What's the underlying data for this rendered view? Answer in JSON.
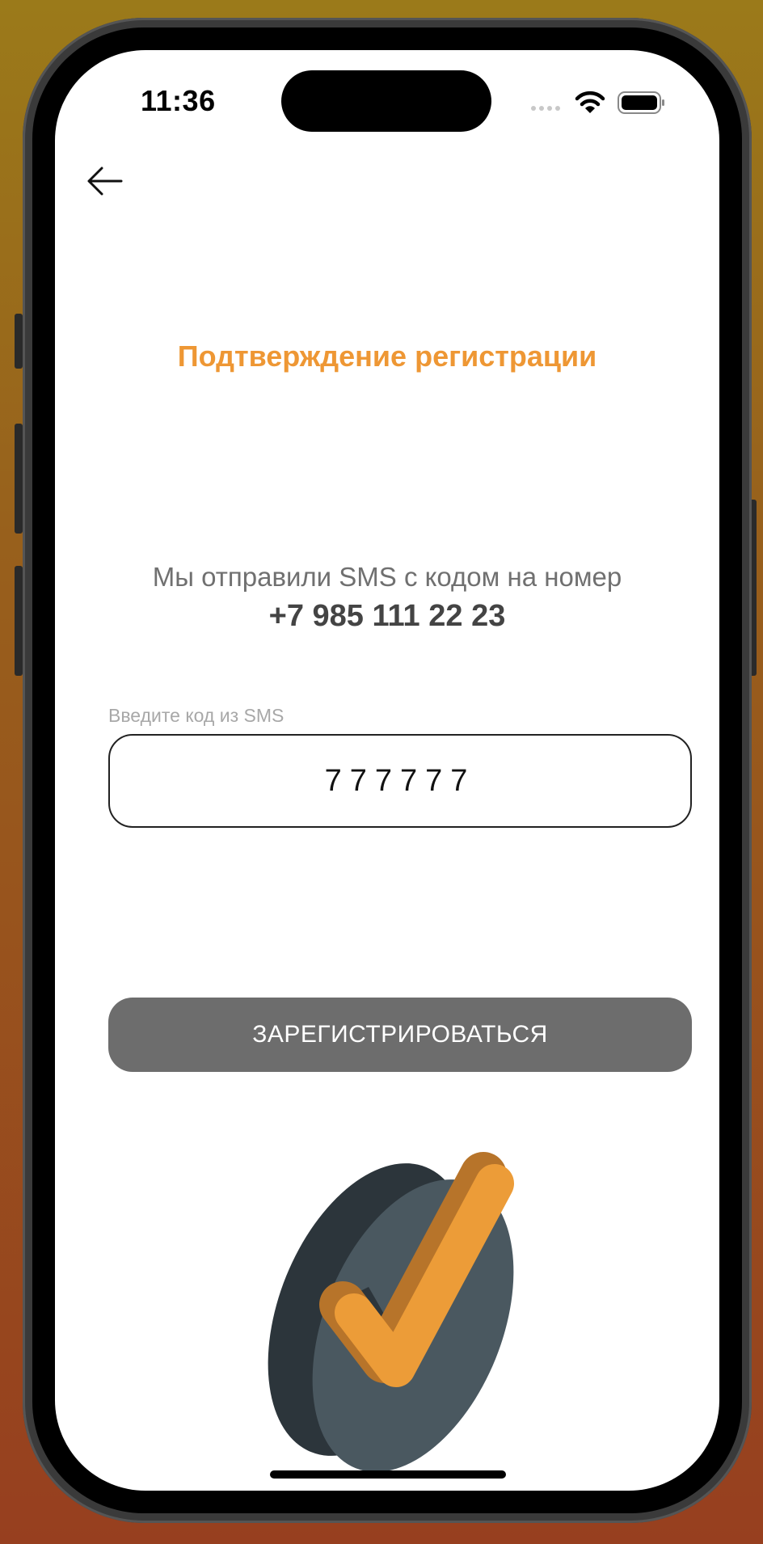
{
  "status_bar": {
    "time": "11:36"
  },
  "header": {
    "back_icon": "arrow-left-icon"
  },
  "main": {
    "title": "Подтверждение регистрации",
    "sent_text": "Мы отправили SMS с кодом на номер",
    "phone_number": "+7 985 111 22 23",
    "code_label": "Введите код из SMS",
    "code_value": "777777",
    "register_button": "ЗАРЕГИСТРИРОВАТЬСЯ"
  },
  "colors": {
    "accent": "#ee9734",
    "button_bg": "#6d6d6d",
    "disc": "#4a5860",
    "disc_dark": "#2c353b"
  },
  "illustration": {
    "icon": "checkmark-disc-icon"
  }
}
